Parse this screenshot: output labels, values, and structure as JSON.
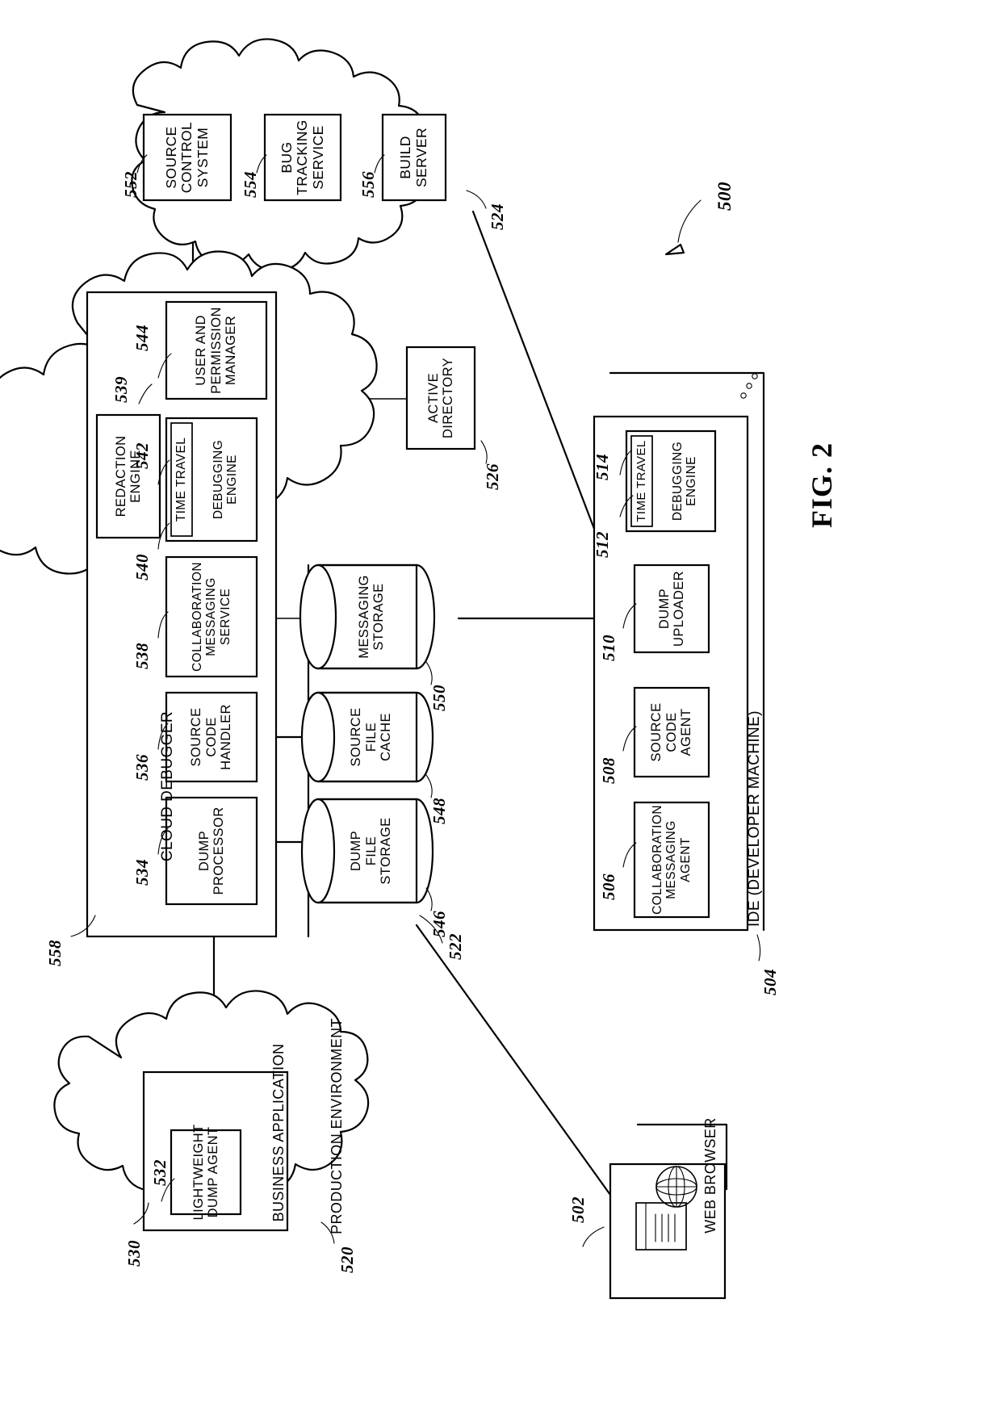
{
  "figure": {
    "label": "FIG. 2",
    "system_ref": "500"
  },
  "clouds": {
    "services_cloud": {
      "ref": "524",
      "boxes": [
        {
          "ref": "552",
          "lines": [
            "SOURCE",
            "CONTROL",
            "SYSTEM"
          ]
        },
        {
          "ref": "554",
          "lines": [
            "BUG",
            "TRACKING",
            "SERVICE"
          ]
        },
        {
          "ref": "556",
          "lines": [
            "BUILD",
            "SERVER"
          ]
        }
      ]
    },
    "cloud_debugger_cloud": {
      "ref": "522",
      "container_ref": "558",
      "container_label": "CLOUD DEBUGGER",
      "boxes": [
        {
          "ref": "534",
          "lines": [
            "DUMP",
            "PROCESSOR"
          ]
        },
        {
          "ref": "536",
          "lines": [
            "SOURCE",
            "CODE",
            "HANDLER"
          ]
        },
        {
          "ref": "538",
          "lines": [
            "COLLABORATION",
            "MESSAGING",
            "SERVICE"
          ]
        },
        {
          "ref": "539",
          "lines": [
            "REDACTION",
            "ENGINE"
          ]
        },
        {
          "ref": "544",
          "lines": [
            "USER AND",
            "PERMISSION",
            "MANAGER"
          ]
        }
      ],
      "nested_engine": {
        "outer_ref": "540",
        "inner_ref": "542",
        "inner_label": "TIME TRAVEL",
        "outer_lines": [
          "DEBUGGING",
          "ENGINE"
        ]
      },
      "stores": [
        {
          "ref": "546",
          "lines": [
            "DUMP",
            "FILE",
            "STORAGE"
          ]
        },
        {
          "ref": "548",
          "lines": [
            "SOURCE",
            "FILE",
            "CACHE"
          ]
        },
        {
          "ref": "550",
          "lines": [
            "MESSAGING",
            "STORAGE"
          ]
        }
      ]
    },
    "production_cloud": {
      "ref": "520",
      "label": "PRODUCTION ENVIRONMENT",
      "app_ref": "530",
      "app_label": "BUSINESS APPLICATION",
      "agent_ref": "532",
      "agent_lines": [
        "LIGHTWEIGHT",
        "DUMP AGENT"
      ]
    }
  },
  "active_directory": {
    "ref": "526",
    "lines": [
      "ACTIVE",
      "DIRECTORY"
    ]
  },
  "ide": {
    "ref": "504",
    "label": "IDE (DEVELOPER MACHINE)",
    "boxes": [
      {
        "ref": "506",
        "lines": [
          "COLLABORATION",
          "MESSAGING",
          "AGENT"
        ]
      },
      {
        "ref": "508",
        "lines": [
          "SOURCE",
          "CODE",
          "AGENT"
        ]
      },
      {
        "ref": "510",
        "lines": [
          "DUMP",
          "UPLOADER"
        ]
      }
    ],
    "nested_engine": {
      "outer_ref": "514",
      "inner_ref": "512",
      "inner_label": "TIME TRAVEL",
      "outer_lines": [
        "DEBUGGING",
        "ENGINE"
      ]
    }
  },
  "web_browser": {
    "ref": "502",
    "label": "WEB BROWSER",
    "globe_icon": "globe-icon",
    "page_icon": "document-lines-icon"
  }
}
